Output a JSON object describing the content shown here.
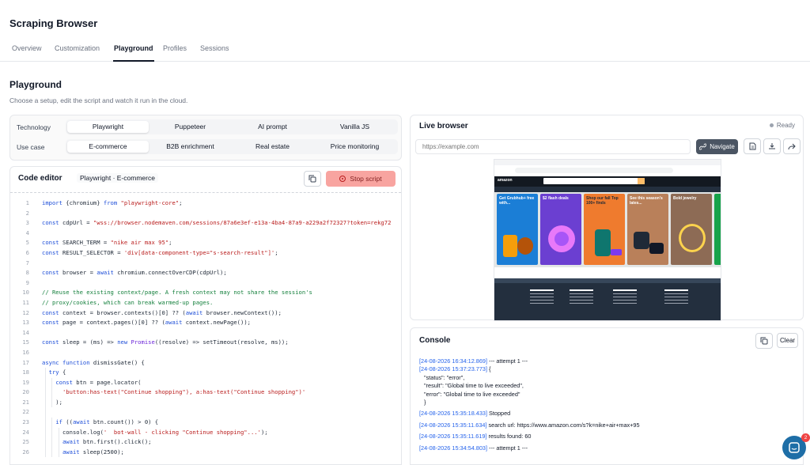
{
  "app": {
    "title": "Scraping Browser"
  },
  "tabs": [
    "Overview",
    "Customization",
    "Playground",
    "Profiles",
    "Sessions"
  ],
  "playground": {
    "title": "Playground",
    "subtitle": "Choose a setup, edit the script and watch it run in the cloud."
  },
  "setup": {
    "technology_label": "Technology",
    "technology_options": [
      "Playwright",
      "Puppeteer",
      "AI prompt",
      "Vanilla JS"
    ],
    "technology_selected": "Playwright",
    "usecase_label": "Use case",
    "usecase_options": [
      "E-commerce",
      "B2B enrichment",
      "Real estate",
      "Price monitoring"
    ],
    "usecase_selected": "E-commerce"
  },
  "editor": {
    "title": "Code editor",
    "preset": "Playwright · E-commerce",
    "stop_label": "Stop script",
    "lines": [
      {
        "n": "1",
        "html": "<span class=\"kw\">import</span> {chromium} <span class=\"kw\">from</span> <span class=\"str\">\"playwright-core\"</span>;"
      },
      {
        "n": "2",
        "html": ""
      },
      {
        "n": "3",
        "html": "<span class=\"kw\">const</span> cdpUrl = <span class=\"str\">\"wss://browser.nodemaven.com/sessions/87a6e3ef-e13a-4ba4-87a9-a229a2f72327?token=rekg72</span>"
      },
      {
        "n": "4",
        "html": ""
      },
      {
        "n": "5",
        "html": "<span class=\"kw\">const</span> SEARCH_TERM = <span class=\"str\">\"nike air max 95\"</span>;"
      },
      {
        "n": "6",
        "html": "<span class=\"kw\">const</span> RESULT_SELECTOR = <span class=\"str\">'div[data-component-type=\"s-search-result\"]'</span>;"
      },
      {
        "n": "7",
        "html": ""
      },
      {
        "n": "8",
        "html": "<span class=\"kw\">const</span> browser = <span class=\"kw\">await</span> chromium.connectOverCDP(cdpUrl);"
      },
      {
        "n": "9",
        "html": ""
      },
      {
        "n": "10",
        "html": "<span class=\"cm\">// Reuse the existing context/page. A fresh context may not share the session's</span>"
      },
      {
        "n": "11",
        "html": "<span class=\"cm\">// proxy/cookies, which can break warmed-up pages.</span>"
      },
      {
        "n": "12",
        "html": "<span class=\"kw\">const</span> context = browser.contexts()[0] ?? (<span class=\"kw\">await</span> browser.newContext());"
      },
      {
        "n": "13",
        "html": "<span class=\"kw\">const</span> page = context.pages()[0] ?? (<span class=\"kw\">await</span> context.newPage());"
      },
      {
        "n": "14",
        "html": ""
      },
      {
        "n": "15",
        "html": "<span class=\"kw\">const</span> sleep = (ms) => <span class=\"kw\">new</span> <span class=\"fn\">Promise</span>((resolve) => setTimeout(resolve, ms));"
      },
      {
        "n": "16",
        "html": ""
      },
      {
        "n": "17",
        "html": "<span class=\"kw\">async function</span> dismissGate() {"
      },
      {
        "n": "18",
        "html": "  <span class=\"kw\">try</span> {"
      },
      {
        "n": "19",
        "html": "    <span class=\"kw\">const</span> btn = page.locator("
      },
      {
        "n": "20",
        "html": "      <span class=\"str\">'button:has-text(\"Continue shopping\"), a:has-text(\"Continue shopping\")'</span>"
      },
      {
        "n": "21",
        "html": "    );"
      },
      {
        "n": "22",
        "html": ""
      },
      {
        "n": "23",
        "html": "    <span class=\"kw\">if</span> ((<span class=\"kw\">await</span> btn.count()) > 0) {"
      },
      {
        "n": "24",
        "html": "      console.log(<span class=\"str\">'  bot-wall - clicking \"Continue shopping\"...'</span>);"
      },
      {
        "n": "25",
        "html": "      <span class=\"kw\">await</span> btn.first().click();"
      },
      {
        "n": "26",
        "html": "      <span class=\"kw\">await</span> sleep(2500);"
      }
    ]
  },
  "live": {
    "title": "Live browser",
    "status": "Ready",
    "url_placeholder": "https://example.com",
    "navigate_label": "Navigate",
    "site": {
      "logo": "amazon",
      "cards": [
        {
          "title": "Get Grubhub+ free with...",
          "color": "#1b7ed6"
        },
        {
          "title": "$2 flash deals",
          "color": "#6b3fd1"
        },
        {
          "title": "Shop our fall Top 100+ finds",
          "color": "#ef7b2e"
        },
        {
          "title": "See this season's lates...",
          "color": "#b9805a"
        },
        {
          "title": "Bold jewelry",
          "color": "#8d6b55"
        }
      ]
    }
  },
  "console": {
    "title": "Console",
    "clear_label": "Clear",
    "logs": [
      {
        "ts": "[24-08-2026 16:34:12.869]",
        "msg": " --- attempt 1 ---"
      },
      {
        "ts": "[24-08-2026 15:37:23.773]",
        "msg": " {"
      },
      {
        "json": "\"status\": \"error\","
      },
      {
        "json": "\"result\": \"Global time to live exceeded\","
      },
      {
        "json": "\"error\": \"Global time to live exceeded\""
      },
      {
        "json": "}"
      },
      {
        "ts": "[24-08-2026 15:35:18.433]",
        "msg": " Stopped"
      },
      {
        "ts": "[24-08-2026 15:35:11.634]",
        "msg": " search url: https://www.amazon.com/s?k=nike+air+max+95"
      },
      {
        "ts": "[24-08-2026 15:35:11.619]",
        "msg": " results found: 60"
      },
      {
        "ts": "[24-08-2026 15:34:54.803]",
        "msg": " --- attempt 1 ---"
      }
    ]
  },
  "chat": {
    "badge": "2"
  }
}
